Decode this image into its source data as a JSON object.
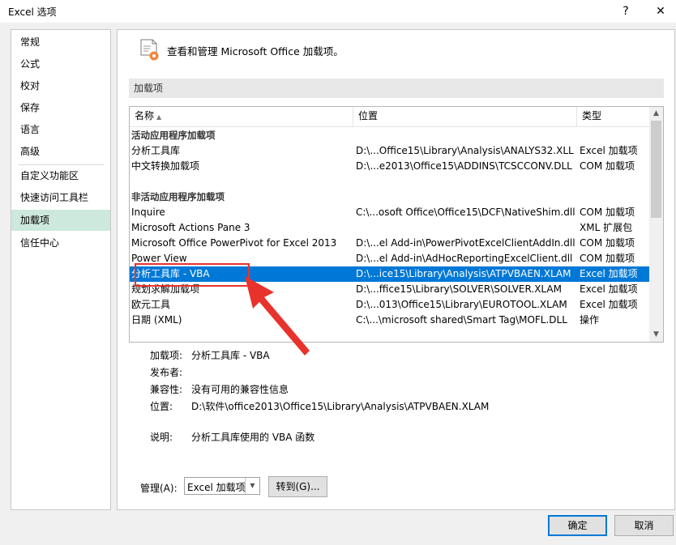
{
  "window": {
    "title": "Excel 选项",
    "help": "?",
    "close": "✕"
  },
  "nav": {
    "items": [
      "常规",
      "公式",
      "校对",
      "保存",
      "语言",
      "高级",
      "自定义功能区",
      "快速访问工具栏",
      "加载项",
      "信任中心"
    ],
    "selected_index": 8
  },
  "header": {
    "text": "查看和管理 Microsoft Office 加载项。"
  },
  "section": {
    "title": "加载项"
  },
  "table": {
    "columns": [
      "名称",
      "位置",
      "类型"
    ],
    "sort_indicator": "▲",
    "groups": [
      {
        "title": "活动应用程序加载项",
        "rows": [
          [
            "分析工具库",
            "D:\\...Office15\\Library\\Analysis\\ANALYS32.XLL",
            "Excel 加载项"
          ],
          [
            "中文转换加载项",
            "D:\\...e2013\\Office15\\ADDINS\\TCSCCONV.DLL",
            "COM 加载项"
          ]
        ]
      },
      {
        "title": "非活动应用程序加载项",
        "rows": [
          [
            "Inquire",
            "C:\\...osoft Office\\Office15\\DCF\\NativeShim.dll",
            "COM 加载项"
          ],
          [
            "Microsoft Actions Pane 3",
            "",
            "XML 扩展包"
          ],
          [
            "Microsoft Office PowerPivot for Excel 2013",
            "D:\\...el Add-in\\PowerPivotExcelClientAddIn.dll",
            "COM 加载项"
          ],
          [
            "Power View",
            "D:\\...el Add-in\\AdHocReportingExcelClient.dll",
            "COM 加载项"
          ],
          [
            "分析工具库 - VBA",
            "D:\\...ice15\\Library\\Analysis\\ATPVBAEN.XLAM",
            "Excel 加载项"
          ],
          [
            "规划求解加载项",
            "D:\\...ffice15\\Library\\SOLVER\\SOLVER.XLAM",
            "Excel 加载项"
          ],
          [
            "欧元工具",
            "D:\\...013\\Office15\\Library\\EUROTOOL.XLAM",
            "Excel 加载项"
          ],
          [
            "日期 (XML)",
            "C:\\...\\microsoft shared\\Smart Tag\\MOFL.DLL",
            "操作"
          ]
        ]
      }
    ],
    "selected_name": "分析工具库 - VBA"
  },
  "details": {
    "addin_label": "加载项:",
    "addin_value": "分析工具库 - VBA",
    "publisher_label": "发布者:",
    "publisher_value": "",
    "compat_label": "兼容性:",
    "compat_value": "没有可用的兼容性信息",
    "location_label": "位置:",
    "location_value": "D:\\软件\\office2013\\Office15\\Library\\Analysis\\ATPVBAEN.XLAM",
    "desc_label": "说明:",
    "desc_value": "分析工具库使用的 VBA 函数"
  },
  "manage": {
    "label": "管理(A):",
    "selected": "Excel 加载项",
    "go_label": "转到(G)..."
  },
  "footer": {
    "ok": "确定",
    "cancel": "取消"
  },
  "colors": {
    "selection": "#0078d7",
    "nav_selected": "#cde8dc",
    "annotation": "#e8322b"
  },
  "icons": [
    "addins-gear-icon",
    "sort-up-icon",
    "scroll-up-icon",
    "scroll-down-icon",
    "dropdown-arrow-icon"
  ]
}
